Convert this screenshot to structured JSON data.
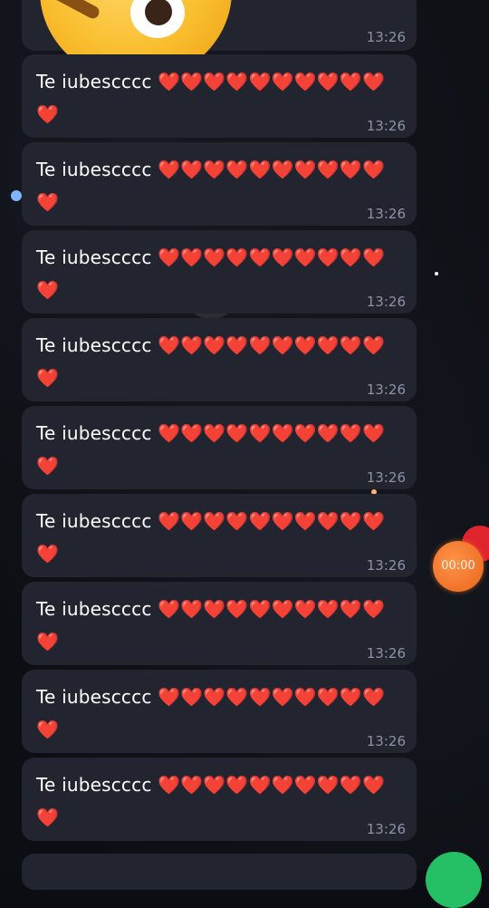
{
  "chat": {
    "top_partial_time": "13:26",
    "messages": [
      {
        "text": "Te iubescccc ❤️❤️❤️❤️❤️❤️❤️❤️❤️❤️❤️",
        "time": "13:26"
      },
      {
        "text": "Te iubescccc ❤️❤️❤️❤️❤️❤️❤️❤️❤️❤️❤️",
        "time": "13:26"
      },
      {
        "text": "Te iubescccc ❤️❤️❤️❤️❤️❤️❤️❤️❤️❤️❤️",
        "time": "13:26"
      },
      {
        "text": "Te iubescccc ❤️❤️❤️❤️❤️❤️❤️❤️❤️❤️❤️",
        "time": "13:26"
      },
      {
        "text": "Te iubescccc ❤️❤️❤️❤️❤️❤️❤️❤️❤️❤️❤️",
        "time": "13:26"
      },
      {
        "text": "Te iubescccc ❤️❤️❤️❤️❤️❤️❤️❤️❤️❤️❤️",
        "time": "13:26"
      },
      {
        "text": "Te iubescccc ❤️❤️❤️❤️❤️❤️❤️❤️❤️❤️❤️",
        "time": "13:26"
      },
      {
        "text": "Te iubescccc ❤️❤️❤️❤️❤️❤️❤️❤️❤️❤️❤️",
        "time": "13:26"
      },
      {
        "text": "Te iubescccc ❤️❤️❤️❤️❤️❤️❤️❤️❤️❤️❤️",
        "time": "13:26"
      }
    ]
  },
  "recorder": {
    "timer": "00:00"
  },
  "colors": {
    "bubble": "#222530",
    "time_text": "#8d93a3",
    "record_button": "#e8641a",
    "send_button": "#25c065"
  },
  "icons": {
    "sticker": "emoji-face-icon",
    "send": "send-icon"
  }
}
